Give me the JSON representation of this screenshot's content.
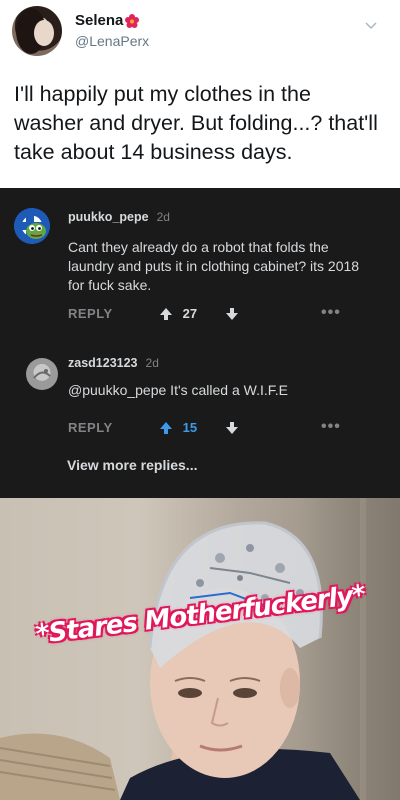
{
  "tweet": {
    "display_name": "Selena",
    "handle": "@LenaPerx",
    "text": "I'll happily put my clothes in the washer and dryer. But folding...? that'll take about 14 business days."
  },
  "comments": [
    {
      "username": "puukko_pepe",
      "age": "2d",
      "body": "Cant they already do a robot that folds the laundry and puts it in clothing cabinet? its 2018 for fuck sake.",
      "reply_label": "REPLY",
      "score": "27",
      "score_color": "#d7dadc",
      "upvote_active": false,
      "more_label": "•••"
    },
    {
      "username": "zasd123123",
      "age": "2d",
      "body": "@puukko_pepe It's called a W.I.F.E",
      "reply_label": "REPLY",
      "score": "15",
      "score_color": "#3d9be9",
      "upvote_active": true,
      "more_label": "•••"
    }
  ],
  "view_more": "View more replies...",
  "meme": {
    "caption": "*Stares Motherfuckerly*"
  },
  "colors": {
    "twitter_text": "#14171a",
    "twitter_secondary": "#657786",
    "reddit_bg": "#1a1a1b",
    "reddit_text": "#d7dadc",
    "reddit_muted": "#818384",
    "upvote_blue": "#3d9be9",
    "caption_outline": "#e0185a"
  },
  "icons": [
    "flower-icon",
    "chevron-down-icon",
    "upvote-arrow-icon",
    "downvote-arrow-icon",
    "more-dots-icon"
  ]
}
